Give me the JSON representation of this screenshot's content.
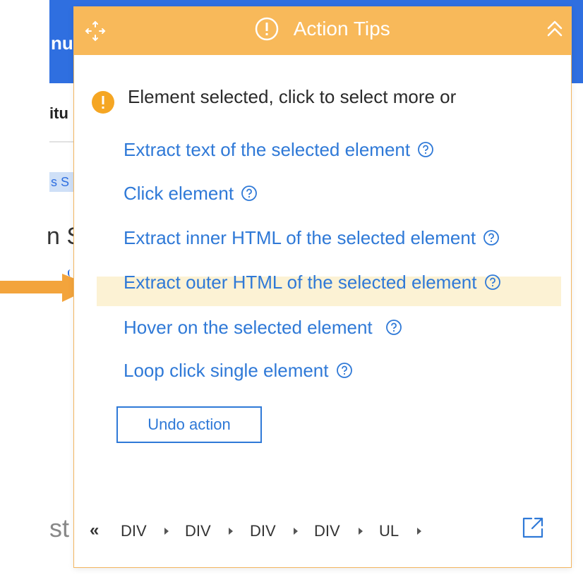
{
  "background": {
    "fragment_nu": "nu",
    "fragment_itu": "itu",
    "fragment_chip": "s S",
    "fragment_n": "n S",
    "fragment_st": "st"
  },
  "panel": {
    "title": "Action Tips",
    "header_color": "#f8b95a",
    "message": "Element selected, click to select more or",
    "actions": [
      {
        "label": "Extract text of the selected element"
      },
      {
        "label": "Click element"
      },
      {
        "label": "Extract inner HTML of the selected element"
      },
      {
        "label": "Extract outer HTML of the selected element"
      },
      {
        "label": "Hover on the selected element"
      },
      {
        "label": "Loop click single element"
      }
    ],
    "highlighted_action_index": 3,
    "undo_label": "Undo action",
    "breadcrumb": {
      "back": "«",
      "items": [
        "DIV",
        "DIV",
        "DIV",
        "DIV",
        "UL"
      ]
    },
    "accent_color": "#2f79d7"
  }
}
